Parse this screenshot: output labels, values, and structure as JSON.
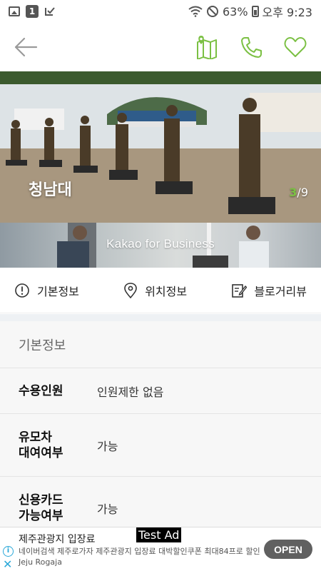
{
  "status_bar": {
    "notification_count": "1",
    "battery_percent": "63%",
    "time": "오후 9:23"
  },
  "hero": {
    "title": "청남대",
    "counter_current": "3",
    "counter_total": "/9"
  },
  "banner": {
    "text": "Kakao for Business"
  },
  "tabs": [
    {
      "label": "기본정보",
      "icon": "info-circle-icon"
    },
    {
      "label": "위치정보",
      "icon": "location-pin-icon"
    },
    {
      "label": "블로거리뷰",
      "icon": "edit-document-icon"
    }
  ],
  "info": {
    "header": "기본정보",
    "rows": [
      {
        "label": "수용인원",
        "value": "인원제한 없음"
      },
      {
        "label": "유모차\n대여여부",
        "value": "가능"
      },
      {
        "label": "신용카드\n가능여부",
        "value": "가능"
      }
    ]
  },
  "ad": {
    "title": "제주관광지 입장료",
    "tag": "Test Ad",
    "description": "네이버검색 제주로가자 제주관광지 입장료 대박할인쿠폰 최대84프로 할인 Jeju Rogaja",
    "button": "OPEN",
    "info_glyph": "i",
    "close_glyph": "✕"
  },
  "colors": {
    "accent": "#7bc043",
    "ad_link": "#2aa8d8",
    "open_button": "#606060"
  }
}
